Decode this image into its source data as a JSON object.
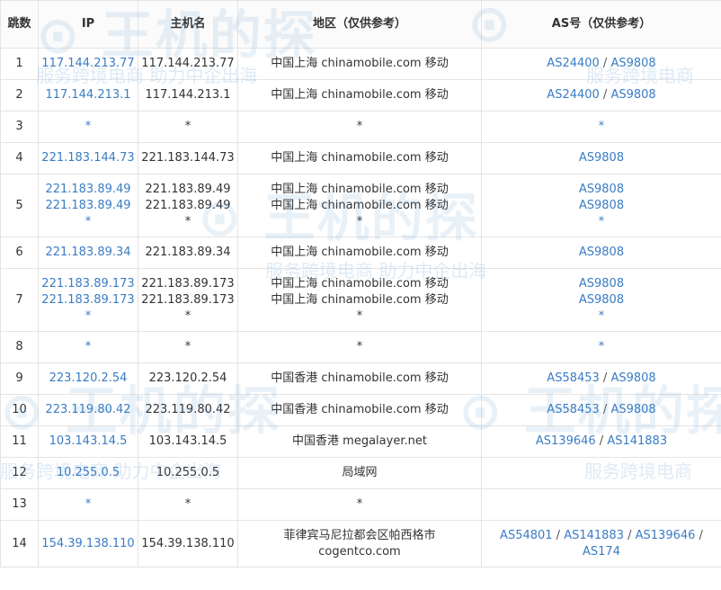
{
  "headers": {
    "hop": "跳数",
    "ip": "IP",
    "host": "主机名",
    "region": "地区（仅供参考）",
    "as": "AS号（仅供参考）"
  },
  "rows": [
    {
      "hop": "1",
      "ips": [
        "117.144.213.77"
      ],
      "hosts": [
        "117.144.213.77"
      ],
      "regions": [
        "中国上海 chinamobile.com 移动"
      ],
      "as_lines": [
        [
          "AS24400",
          "AS9808"
        ]
      ]
    },
    {
      "hop": "2",
      "ips": [
        "117.144.213.1"
      ],
      "hosts": [
        "117.144.213.1"
      ],
      "regions": [
        "中国上海 chinamobile.com 移动"
      ],
      "as_lines": [
        [
          "AS24400",
          "AS9808"
        ]
      ]
    },
    {
      "hop": "3",
      "ips": [
        "*"
      ],
      "hosts": [
        "*"
      ],
      "regions": [
        "*"
      ],
      "as_lines": [
        [
          "*"
        ]
      ]
    },
    {
      "hop": "4",
      "ips": [
        "221.183.144.73"
      ],
      "hosts": [
        "221.183.144.73"
      ],
      "regions": [
        "中国上海 chinamobile.com 移动"
      ],
      "as_lines": [
        [
          "AS9808"
        ]
      ]
    },
    {
      "hop": "5",
      "ips": [
        "221.183.89.49",
        "221.183.89.49",
        "*"
      ],
      "hosts": [
        "221.183.89.49",
        "221.183.89.49",
        "*"
      ],
      "regions": [
        "中国上海 chinamobile.com 移动",
        "中国上海 chinamobile.com 移动",
        "*"
      ],
      "as_lines": [
        [
          "AS9808"
        ],
        [
          "AS9808"
        ],
        [
          "*"
        ]
      ]
    },
    {
      "hop": "6",
      "ips": [
        "221.183.89.34"
      ],
      "hosts": [
        "221.183.89.34"
      ],
      "regions": [
        "中国上海 chinamobile.com 移动"
      ],
      "as_lines": [
        [
          "AS9808"
        ]
      ]
    },
    {
      "hop": "7",
      "ips": [
        "221.183.89.173",
        "221.183.89.173",
        "*"
      ],
      "hosts": [
        "221.183.89.173",
        "221.183.89.173",
        "*"
      ],
      "regions": [
        "中国上海 chinamobile.com 移动",
        "中国上海 chinamobile.com 移动",
        "*"
      ],
      "as_lines": [
        [
          "AS9808"
        ],
        [
          "AS9808"
        ],
        [
          "*"
        ]
      ]
    },
    {
      "hop": "8",
      "ips": [
        "*"
      ],
      "hosts": [
        "*"
      ],
      "regions": [
        "*"
      ],
      "as_lines": [
        [
          "*"
        ]
      ]
    },
    {
      "hop": "9",
      "ips": [
        "223.120.2.54"
      ],
      "hosts": [
        "223.120.2.54"
      ],
      "regions": [
        "中国香港 chinamobile.com 移动"
      ],
      "as_lines": [
        [
          "AS58453",
          "AS9808"
        ]
      ]
    },
    {
      "hop": "10",
      "ips": [
        "223.119.80.42"
      ],
      "hosts": [
        "223.119.80.42"
      ],
      "regions": [
        "中国香港 chinamobile.com 移动"
      ],
      "as_lines": [
        [
          "AS58453",
          "AS9808"
        ]
      ]
    },
    {
      "hop": "11",
      "ips": [
        "103.143.14.5"
      ],
      "hosts": [
        "103.143.14.5"
      ],
      "regions": [
        "中国香港 megalayer.net"
      ],
      "as_lines": [
        [
          "AS139646",
          "AS141883"
        ]
      ]
    },
    {
      "hop": "12",
      "ips": [
        "10.255.0.5"
      ],
      "hosts": [
        "10.255.0.5"
      ],
      "regions": [
        "局域网"
      ],
      "as_lines": []
    },
    {
      "hop": "13",
      "ips": [
        "*"
      ],
      "hosts": [
        "*"
      ],
      "regions": [
        "*"
      ],
      "as_lines": []
    },
    {
      "hop": "14",
      "ips": [
        "154.39.138.110"
      ],
      "hosts": [
        "154.39.138.110"
      ],
      "regions": [
        "菲律宾马尼拉都会区帕西格市",
        "cogentco.com"
      ],
      "as_lines": [
        [
          "AS54801",
          "AS141883",
          "AS139646",
          ""
        ],
        [
          "AS174"
        ]
      ]
    }
  ],
  "watermark": {
    "slogan": "服务跨境电商 助力中企出海",
    "slogan_short": "服务跨境电商"
  },
  "colors": {
    "link": "#3a7cc4",
    "border": "#e4e4e4",
    "watermark": "#468cc8"
  }
}
